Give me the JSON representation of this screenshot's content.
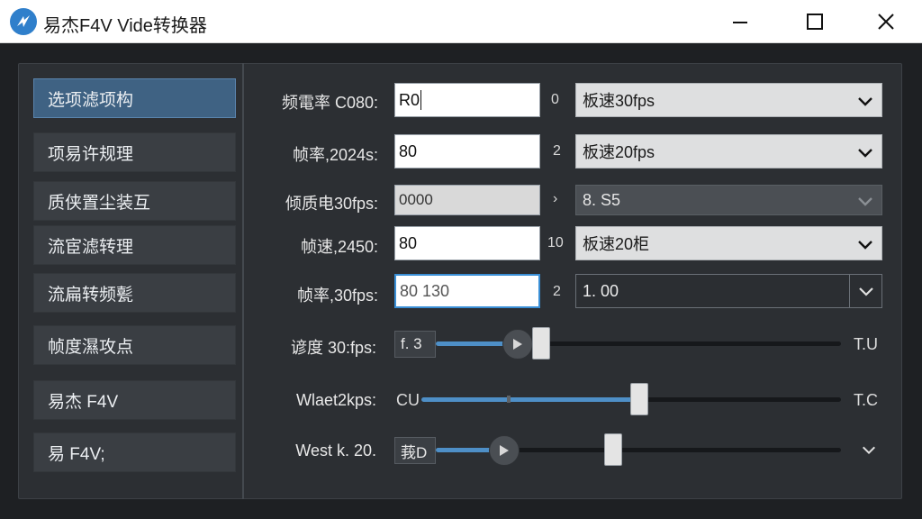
{
  "window": {
    "title": "易杰F4V Vide转换器",
    "colors": {
      "accent": "#3f6283",
      "fill": "#4e8fc7",
      "focus": "#3a8fd6"
    }
  },
  "sidebar": {
    "items": [
      {
        "label": "选项滤项构",
        "active": true
      },
      {
        "label": "项易许规理"
      },
      {
        "label": "质侠置尘装互"
      },
      {
        "label": "流宦滤转理"
      },
      {
        "label": "流扁转频甏"
      },
      {
        "label": "帧度濕攻点"
      },
      {
        "label": "易杰 F4V"
      },
      {
        "label": "易 F4V;"
      }
    ]
  },
  "rows": [
    {
      "label": "频電率 C080:",
      "value": "R0",
      "num": "0",
      "select": "板速30fps"
    },
    {
      "label": "帧率,2024s:",
      "value": "80",
      "num": "2",
      "select": "板速20fps"
    },
    {
      "label": "倾质电30fps:",
      "value": "0000",
      "num": "›",
      "select": "8. S5"
    },
    {
      "label": "帧速,2450:",
      "value": "80",
      "num": "10",
      "select": "板速20柜"
    },
    {
      "label": "帧率,30fps:",
      "value": "80 130",
      "num": "2",
      "select": "1. 00"
    }
  ],
  "sliders": [
    {
      "label": "谚度 30:fps:",
      "value_box": "f. 3",
      "end": "T.U",
      "level": 0.26
    },
    {
      "label": "Wlaet2kps:",
      "value_box": "CU",
      "end": "T.C",
      "level": 0.52
    },
    {
      "label": "West  k. 20.",
      "value_box": "莪D",
      "end": "",
      "level": 0.14
    }
  ],
  "icons": {
    "app": "app-logo-icon",
    "minimize": "minimize-icon",
    "maximize": "maximize-icon",
    "close": "close-icon",
    "dropdown": "chevron-down-icon",
    "play": "play-icon"
  }
}
